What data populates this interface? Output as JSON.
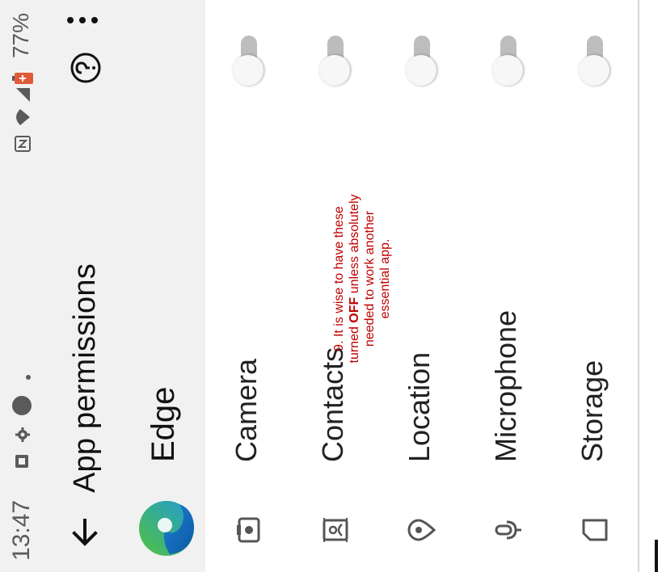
{
  "status_bar": {
    "time": "13:47",
    "battery": "77%",
    "icons": [
      "app-notification-icon",
      "settings-icon",
      "dot-icon",
      "nfc-icon",
      "wifi-icon",
      "signal-icon",
      "battery-icon"
    ]
  },
  "app_bar": {
    "title": "App permissions",
    "back_icon": "back-arrow-icon",
    "help_icon": "help-icon",
    "menu_icon": "more-vertical-icon"
  },
  "app": {
    "name": "Edge",
    "icon": "edge-logo"
  },
  "permissions": [
    {
      "label": "Camera",
      "icon": "camera-icon",
      "enabled": false
    },
    {
      "label": "Contacts",
      "icon": "contacts-icon",
      "enabled": false
    },
    {
      "label": "Location",
      "icon": "location-icon",
      "enabled": false
    },
    {
      "label": "Microphone",
      "icon": "microphone-icon",
      "enabled": false
    },
    {
      "label": "Storage",
      "icon": "storage-icon",
      "enabled": false
    }
  ],
  "annotation": {
    "prefix": "9. It is wise to have these turned ",
    "emphasis": "OFF",
    "suffix": " unless absolutely needed to work another essential app.",
    "color": "#c00000"
  },
  "colors": {
    "toolbar_bg": "#f1f1f1",
    "toggle_track_off": "#bdbdbd",
    "edge_blue": "#0c59a4",
    "edge_green": "#53c23f"
  }
}
